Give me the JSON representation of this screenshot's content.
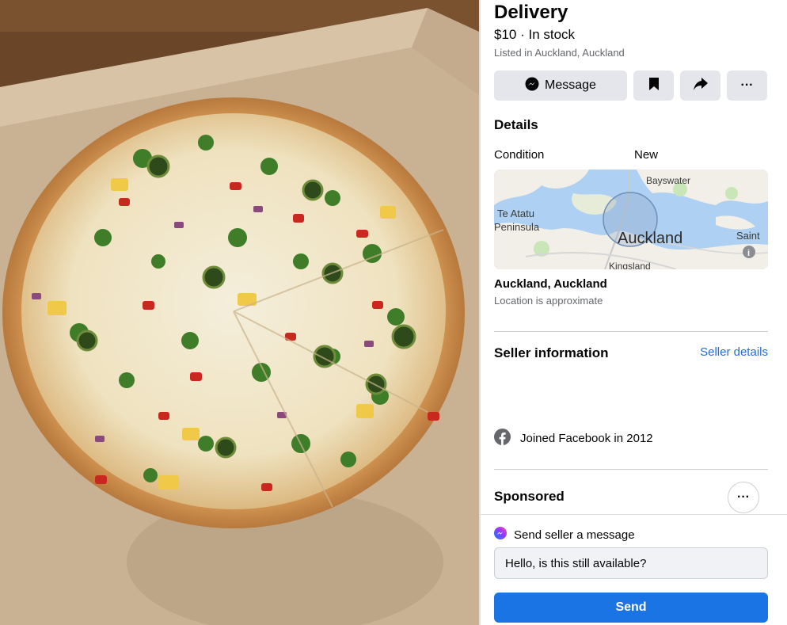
{
  "photo": {
    "alt_subject": "pizza-photo"
  },
  "listing": {
    "title": "Delivery",
    "price_status": "$10 · In stock",
    "listed_in": "Listed in Auckland, Auckland"
  },
  "actions": {
    "message_label": "Message",
    "save_icon": "bookmark-icon",
    "share_icon": "share-icon",
    "more_label": "···"
  },
  "details": {
    "heading": "Details",
    "condition_key": "Condition",
    "condition_value": "New"
  },
  "map": {
    "labels": {
      "bayswater": "Bayswater",
      "te_atatu_1": "Te Atatu",
      "te_atatu_2": "Peninsula",
      "auckland": "Auckland",
      "saint": "Saint",
      "kingsland": "Kingsland"
    }
  },
  "location": {
    "name": "Auckland, Auckland",
    "note": "Location is approximate"
  },
  "seller": {
    "heading": "Seller information",
    "details_link": "Seller details",
    "joined": "Joined Facebook in 2012"
  },
  "sponsored": {
    "heading": "Sponsored",
    "more_label": "···"
  },
  "message": {
    "label": "Send seller a message",
    "input_value": "Hello, is this still available?",
    "send_label": "Send"
  },
  "colors": {
    "accent": "#1b74e4",
    "link": "#216fdb",
    "button_grey": "#e4e6eb",
    "muted_text": "#65676b"
  }
}
